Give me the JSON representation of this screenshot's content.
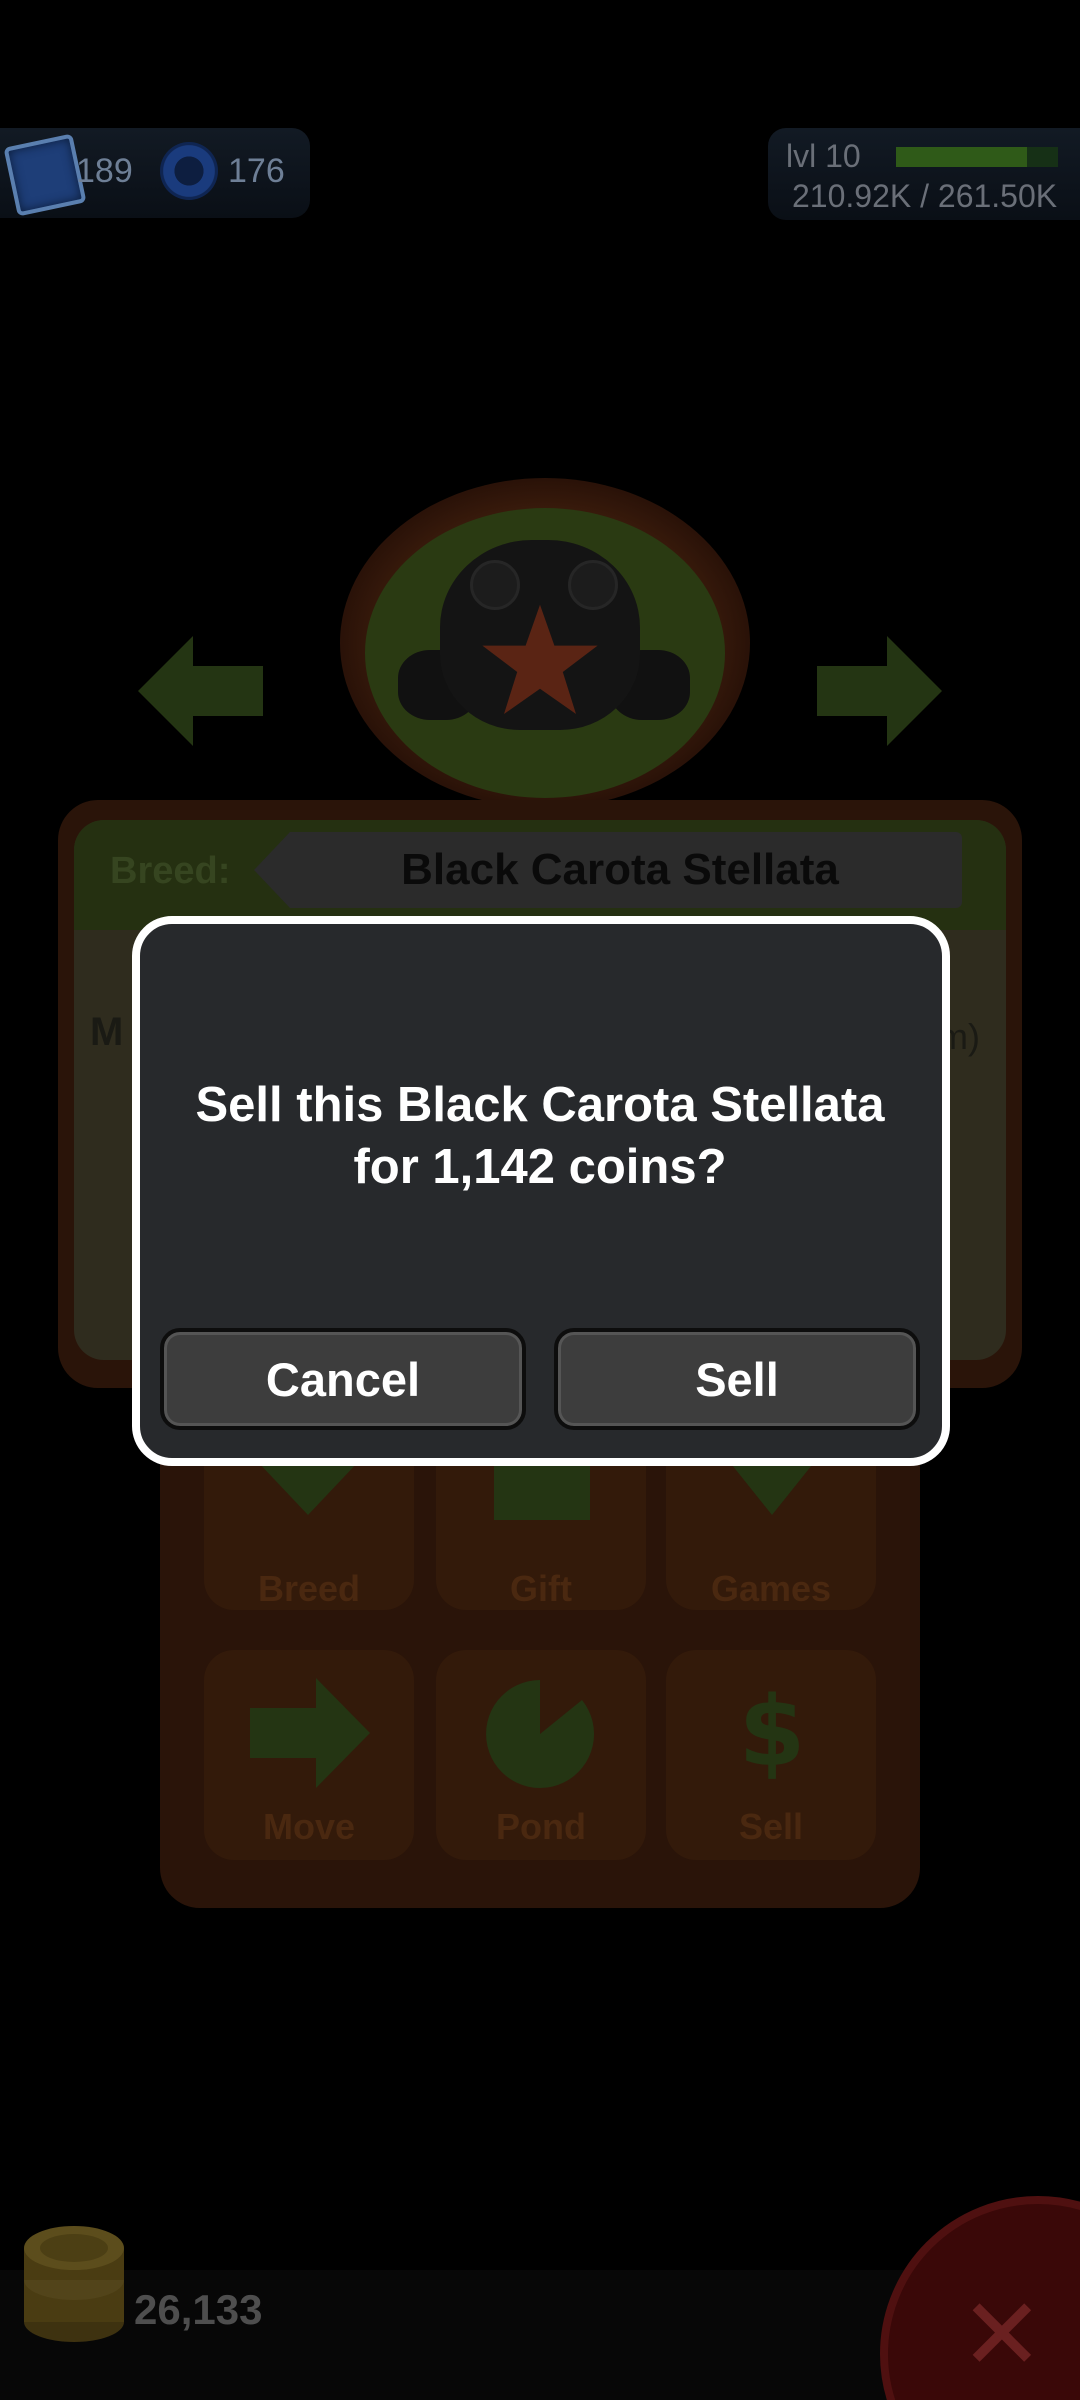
{
  "hud": {
    "stamps": "189",
    "rings": "176",
    "level": "lvl 10",
    "xp_text": "210.92K / 261.50K",
    "xp_progress": 0.81
  },
  "frog": {
    "breed_label": "Breed:",
    "breed_name": "Black Carota Stellata",
    "info_left_stub": "M",
    "info_right_stub": "m)"
  },
  "actions": [
    {
      "label": "Breed",
      "icon": "heart-icon"
    },
    {
      "label": "Gift",
      "icon": "gift-icon"
    },
    {
      "label": "Games",
      "icon": "spinning-top-icon"
    },
    {
      "label": "Move",
      "icon": "arrow-right-icon"
    },
    {
      "label": "Pond",
      "icon": "lilypad-icon"
    },
    {
      "label": "Sell",
      "icon": "dollar-icon"
    }
  ],
  "coins": "26,133",
  "dialog": {
    "message_line1": "Sell this Black Carota Stellata",
    "message_line2": "for 1,142 coins?",
    "cancel_label": "Cancel",
    "sell_label": "Sell"
  },
  "colors": {
    "dialog_bg": "#27292c",
    "dialog_border": "#ffffff",
    "button_bg": "#3d3d3d",
    "accent_green": "#4f9c1f",
    "star_orange": "#e0542a"
  }
}
